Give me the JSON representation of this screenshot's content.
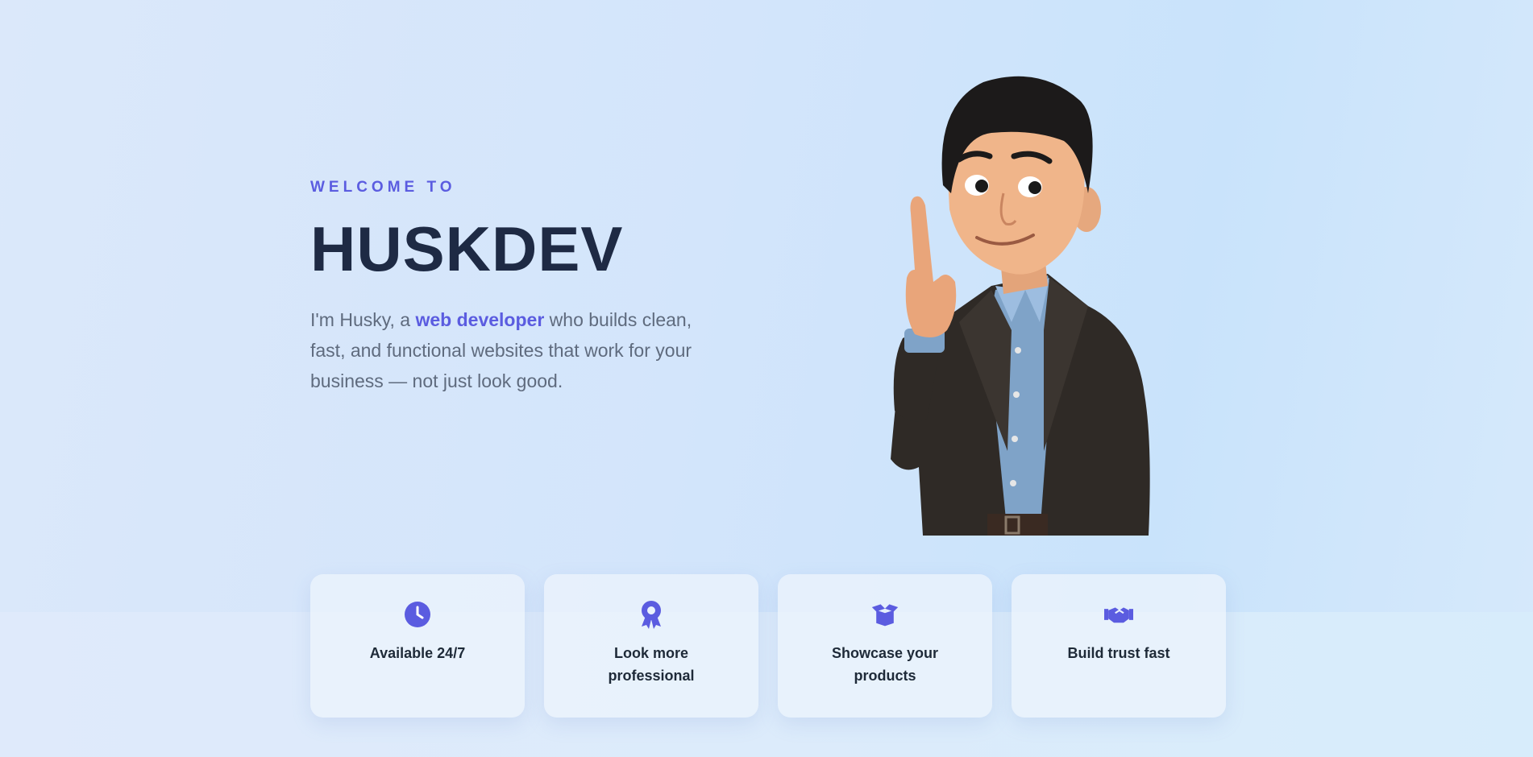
{
  "hero": {
    "eyebrow": "WELCOME TO",
    "title": "HUSKDEV",
    "desc_before": "I'm Husky, a ",
    "desc_highlight": "web developer",
    "desc_after": " who builds clean, fast, and functional websites that work for your business — not just look good."
  },
  "features": [
    {
      "icon": "clock-icon",
      "label": "Available 24/7"
    },
    {
      "icon": "award-ribbon-icon",
      "label": "Look more professional"
    },
    {
      "icon": "open-box-icon",
      "label": "Showcase your products"
    },
    {
      "icon": "handshake-icon",
      "label": "Build trust fast"
    }
  ],
  "colors": {
    "accent": "#5b5ce0",
    "heading": "#1e2a44",
    "body_text": "#5f6b7e"
  }
}
